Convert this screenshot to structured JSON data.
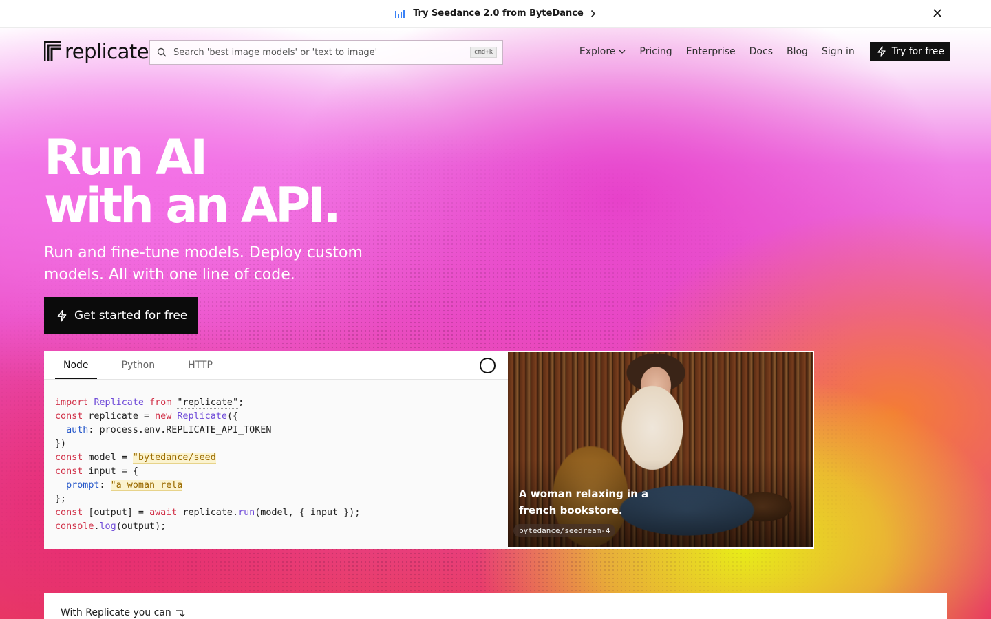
{
  "announcement": {
    "text": "Try Seedance 2.0 from ByteDance",
    "icon": "bar-chart-icon",
    "close_icon": "close-icon"
  },
  "brand": {
    "name": "replicate"
  },
  "search": {
    "placeholder": "Search 'best image models' or 'text to image'",
    "shortcut": "cmd+k"
  },
  "nav": {
    "items": [
      "Explore",
      "Pricing",
      "Enterprise",
      "Docs",
      "Blog",
      "Sign in"
    ],
    "cta": "Try for free"
  },
  "hero": {
    "title_line1": "Run AI",
    "title_line2": "with an API.",
    "subtitle": "Run and fine-tune models. Deploy custom models. All with one line of code.",
    "button": "Get started for free"
  },
  "code": {
    "tabs": [
      "Node",
      "Python",
      "HTTP"
    ],
    "active_tab": "Node",
    "model_value": "\"bytedance/seed",
    "prompt_value": "\"a woman rela"
  },
  "preview": {
    "caption": "A woman relaxing in a french bookstore.",
    "model_tag": "bytedance/seedream-4"
  },
  "bottom": {
    "lead": "With Replicate you can"
  },
  "colors": {
    "accent": "#111111",
    "hero_pink": "#ea4fc4",
    "hero_yellow": "#e8f514"
  }
}
